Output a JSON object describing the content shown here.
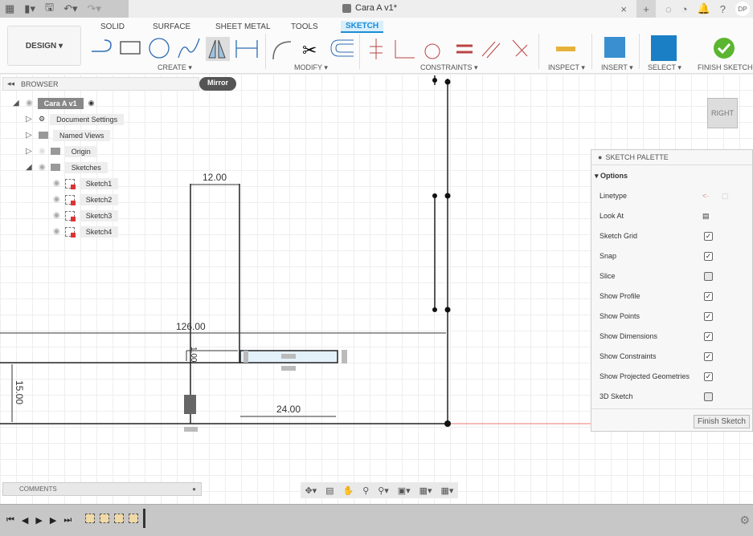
{
  "titlebar": {
    "document_title": "Cara A v1*",
    "user_initials": "DP"
  },
  "toolbar": {
    "workspace": "DESIGN ▾",
    "tabs": [
      {
        "label": "SOLID"
      },
      {
        "label": "SURFACE"
      },
      {
        "label": "SHEET METAL"
      },
      {
        "label": "TOOLS"
      },
      {
        "label": "SKETCH",
        "active": true
      }
    ],
    "groups": {
      "create": "CREATE ▾",
      "modify": "MODIFY ▾",
      "constraints": "CONSTRAINTS ▾",
      "inspect": "INSPECT ▾",
      "insert": "INSERT ▾",
      "select": "SELECT ▾",
      "finish": "FINISH SKETCH ▾"
    },
    "tooltip": "Mirror",
    "accent": "#1a8ed6"
  },
  "browser": {
    "title": "BROWSER",
    "root": "Cara A v1",
    "items": [
      {
        "label": "Document Settings"
      },
      {
        "label": "Named Views"
      },
      {
        "label": "Origin"
      },
      {
        "label": "Sketches"
      }
    ],
    "sketches": [
      {
        "label": "Sketch1"
      },
      {
        "label": "Sketch2"
      },
      {
        "label": "Sketch3"
      },
      {
        "label": "Sketch4"
      }
    ]
  },
  "palette": {
    "title": "SKETCH PALETTE",
    "section": "Options",
    "options": [
      {
        "label": "Linetype"
      },
      {
        "label": "Look At"
      },
      {
        "label": "Sketch Grid",
        "checked": true
      },
      {
        "label": "Snap",
        "checked": true
      },
      {
        "label": "Slice",
        "checked": false
      },
      {
        "label": "Show Profile",
        "checked": true
      },
      {
        "label": "Show Points",
        "checked": true
      },
      {
        "label": "Show Dimensions",
        "checked": true
      },
      {
        "label": "Show Constraints",
        "checked": true
      },
      {
        "label": "Show Projected Geometries",
        "checked": true
      },
      {
        "label": "3D Sketch",
        "checked": false
      }
    ],
    "finish_button": "Finish Sketch"
  },
  "canvas": {
    "dimensions": {
      "d12": "12.00",
      "d126": "126.00",
      "d15": "15.00",
      "d24": "24.00",
      "d1": "1.00"
    },
    "viewcube": "RIGHT"
  },
  "comments": {
    "title": "COMMENTS"
  }
}
